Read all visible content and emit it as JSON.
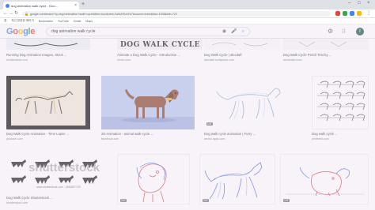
{
  "browser": {
    "tab_title": "dog animation walk cycle - Goo...",
    "omnibox_url": "google.com/search?q=dog+animation+walk+cycle&tbm=isch&ved=2ahUKEwiYk7&source=lnms&biw=1536&bih=722",
    "bookmarks": [
      "앱",
      "최근 방문한 페이지",
      "Bookmarks",
      "YouTube",
      "Gmail",
      "Maps"
    ]
  },
  "google": {
    "logo_letters": [
      {
        "ch": "G",
        "color": "#4285f4"
      },
      {
        "ch": "o",
        "color": "#ea4335"
      },
      {
        "ch": "o",
        "color": "#fbbc05"
      },
      {
        "ch": "g",
        "color": "#4285f4"
      },
      {
        "ch": "l",
        "color": "#34a853"
      },
      {
        "ch": "e",
        "color": "#ea4335"
      }
    ],
    "query": "dog animation walk cycle",
    "avatar_initial": "I"
  },
  "results": {
    "row1": [
      {
        "title": "Running Dog Animation Images, Stock ...",
        "source": "shutterstock.com"
      },
      {
        "title": "Animate a Dog Walk Cycle - Introduction ...",
        "source": "vimeo.com",
        "banner": "DOG WALK CYCLE"
      },
      {
        "title": "Dog Walk Cycle | alecdalf",
        "source": "alecdalf.wordpress.com"
      },
      {
        "title": "Dog Walk Cycle Pencil Test by ...",
        "source": "deviantart.com"
      }
    ],
    "row2": [
      {
        "title": "Dog Walk Cycle Animation - Time Lapse ...",
        "source": "youtube.com"
      },
      {
        "title": "2D Animation - animal walk cycle ...",
        "source": "facebook.com"
      },
      {
        "title": "Dog walk cycle animation | Furry ...",
        "source": "amino apps.com",
        "gif": "GIF"
      },
      {
        "title": "Dog walk cycle ...",
        "source": "pinterest.com"
      }
    ],
    "row3": [
      {
        "title": "Dog Walk Cycle Shutterstock ...",
        "source": "shutterstock.com",
        "watermark": "shutterstock",
        "id": "www.shutterstock.com · 2452857729"
      },
      {
        "title": "",
        "source": "",
        "gif": "GIF"
      },
      {
        "title": "",
        "source": "",
        "gif": "GIF"
      },
      {
        "title": "",
        "source": "",
        "gif": "GIF"
      }
    ]
  },
  "colors": {
    "accent": "#4285f4",
    "dachshund": "#8b4a2f",
    "walk_bg": "#b9c9ee"
  }
}
